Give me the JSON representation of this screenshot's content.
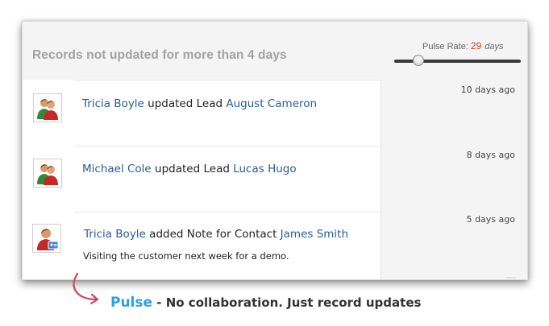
{
  "header": {
    "title": "Records not updated for more than 4 days",
    "pulse_rate_label": "Pulse Rate:",
    "pulse_rate_value": "29",
    "pulse_rate_unit": "days",
    "slider_level_fraction": 0.2
  },
  "feed": [
    {
      "user": "Tricia Boyle",
      "action": "updated Lead",
      "target": "August Cameron",
      "note": "",
      "time": "10 days ago",
      "avatar": "group-users-icon"
    },
    {
      "user": "Michael Cole",
      "action": "updated Lead",
      "target": "Lucas Hugo",
      "note": "",
      "time": "8 days ago",
      "avatar": "group-users-icon"
    },
    {
      "user": "Tricia Boyle",
      "action": "added Note for Contact",
      "target": "James Smith",
      "note": "Visiting the customer next week for a demo.",
      "time": "5 days ago",
      "avatar": "contact-card-icon"
    }
  ],
  "caption": {
    "brand": "Pulse",
    "description": " - No collaboration. Just record updates"
  },
  "colors": {
    "link": "#2a5c93",
    "pulse_value": "#d0392f",
    "brand": "#2e9ee4",
    "header_title": "#a2a2a2",
    "arrow": "#d0495b"
  }
}
